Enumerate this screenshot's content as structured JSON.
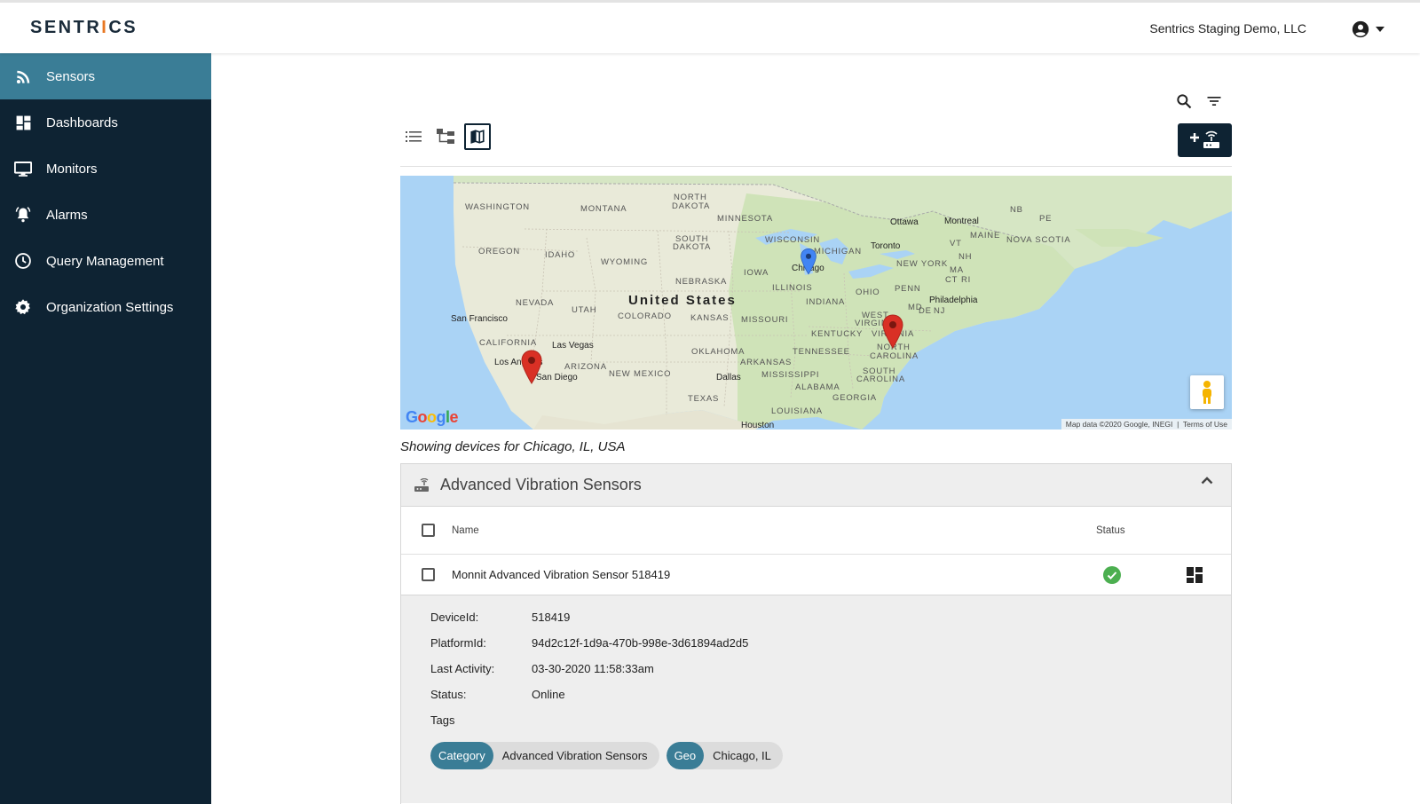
{
  "header": {
    "logo_prefix": "SENTR",
    "logo_i": "I",
    "logo_suffix": "CS",
    "org_name": "Sentrics Staging Demo, LLC",
    "account_icon": "account-circle-icon"
  },
  "sidebar": {
    "items": [
      {
        "label": "Sensors",
        "icon": "rss-feed-icon",
        "active": true
      },
      {
        "label": "Dashboards",
        "icon": "dashboard-icon",
        "active": false
      },
      {
        "label": "Monitors",
        "icon": "monitor-icon",
        "active": false
      },
      {
        "label": "Alarms",
        "icon": "bell-icon",
        "active": false
      },
      {
        "label": "Query Management",
        "icon": "clock-icon",
        "active": false
      },
      {
        "label": "Organization Settings",
        "icon": "gear-icon",
        "active": false
      }
    ]
  },
  "map": {
    "labels": {
      "washington": "WASHINGTON",
      "montana": "MONTANA",
      "north_dakota_1": "NORTH",
      "north_dakota_2": "DAKOTA",
      "minnesota": "MINNESOTA",
      "oregon": "OREGON",
      "idaho": "IDAHO",
      "wyoming": "WYOMING",
      "south_dakota_1": "SOUTH",
      "south_dakota_2": "DAKOTA",
      "wisconsin": "WISCONSIN",
      "michigan": "MICHIGAN",
      "nebraska": "NEBRASKA",
      "iowa": "IOWA",
      "illinois": "ILLINOIS",
      "ohio": "OHIO",
      "indiana": "INDIANA",
      "nevada": "NEVADA",
      "utah": "UTAH",
      "colorado": "COLORADO",
      "kansas": "KANSAS",
      "missouri": "MISSOURI",
      "california": "CALIFORNIA",
      "arizona": "ARIZONA",
      "new_mexico": "NEW MEXICO",
      "oklahoma": "OKLAHOMA",
      "arkansas": "ARKANSAS",
      "tennessee": "TENNESSEE",
      "kentucky": "KENTUCKY",
      "mississippi": "MISSISSIPPI",
      "alabama": "ALABAMA",
      "georgia": "GEORGIA",
      "texas": "TEXAS",
      "louisiana": "LOUISIANA",
      "west_virginia_1": "WEST",
      "west_virginia_2": "VIRGINIA",
      "virginia": "VIRGINIA",
      "north_carolina_1": "NORTH",
      "north_carolina_2": "CAROLINA",
      "south_carolina_1": "SOUTH",
      "south_carolina_2": "CAROLINA",
      "penn": "PENN",
      "new_york": "NEW YORK",
      "md": "MD",
      "de": "DE",
      "nj": "NJ",
      "vt": "VT",
      "nh": "NH",
      "ma": "MA",
      "ct": "CT",
      "ri": "RI",
      "maine": "MAINE",
      "nb": "NB",
      "pe": "PE",
      "nova_scotia": "NOVA SCOTIA",
      "united_states": "United States",
      "san_francisco": "San Francisco",
      "las_vegas": "Las Vegas",
      "los_angeles": "Los Angeles",
      "san_diego": "San Diego",
      "dallas": "Dallas",
      "houston": "Houston",
      "chicago": "Chicago",
      "toronto": "Toronto",
      "ottawa": "Ottawa",
      "montreal": "Montreal",
      "philadelphia": "Philadelphia"
    },
    "google_logo": [
      "G",
      "o",
      "o",
      "g",
      "l",
      "e"
    ],
    "credit": "Map data ©2020 Google, INEGI",
    "terms": "Terms of Use"
  },
  "showing_text": "Showing devices for Chicago, IL, USA",
  "panel": {
    "title": "Advanced Vibration Sensors",
    "col_name": "Name",
    "col_status": "Status",
    "rows": [
      {
        "name": "Monnit Advanced Vibration Sensor 518419",
        "status": "online"
      }
    ],
    "detail": {
      "device_id_label": "DeviceId:",
      "device_id": "518419",
      "platform_id_label": "PlatformId:",
      "platform_id": "94d2c12f-1d9a-470b-998e-3d61894ad2d5",
      "last_activity_label": "Last Activity:",
      "last_activity": "03-30-2020 11:58:33am",
      "status_label": "Status:",
      "status": "Online",
      "tags_label": "Tags",
      "tags": [
        {
          "key": "Category",
          "value": "Advanced Vibration Sensors"
        },
        {
          "key": "Geo",
          "value": "Chicago, IL"
        }
      ]
    }
  },
  "colors": {
    "sidebar_bg": "#0e2333",
    "sidebar_active": "#3a7d96",
    "chip_key": "#3a7d96",
    "online_green": "#4caf50",
    "pin_red": "#d93025",
    "pin_blue": "#4285f4"
  }
}
